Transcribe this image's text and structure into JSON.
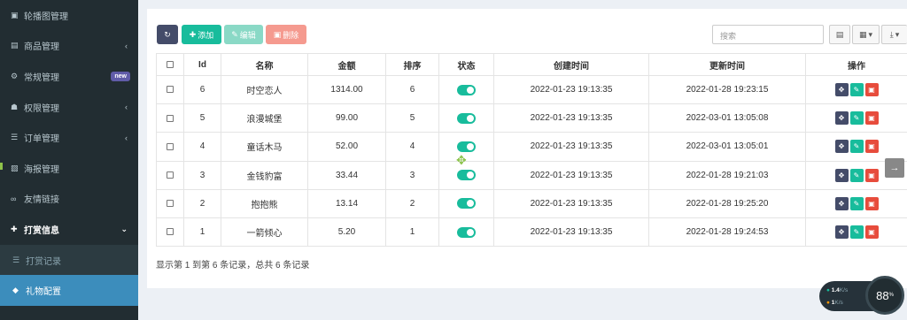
{
  "sidebar": {
    "items": [
      {
        "label": "轮播图管理",
        "icon": "image-icon",
        "glyph": "▣"
      },
      {
        "label": "商品管理",
        "icon": "book-icon",
        "glyph": "▤",
        "arrow": "‹"
      },
      {
        "label": "常规管理",
        "icon": "cogs-icon",
        "glyph": "⚙",
        "badge": "new"
      },
      {
        "label": "权限管理",
        "icon": "users-icon",
        "glyph": "☗",
        "arrow": "‹"
      },
      {
        "label": "订单管理",
        "icon": "list-icon",
        "glyph": "☰",
        "arrow": "‹"
      },
      {
        "label": "海报管理",
        "icon": "picture-icon",
        "glyph": "▨"
      },
      {
        "label": "友情链接",
        "icon": "link-icon",
        "glyph": "∞"
      },
      {
        "label": "打赏信息",
        "icon": "gift-icon",
        "glyph": "✚",
        "arrow": "⌄"
      },
      {
        "label": "打赏记录",
        "icon": "list-alt-icon",
        "glyph": "☰"
      },
      {
        "label": "礼物配置",
        "icon": "cube-icon",
        "glyph": "◆"
      }
    ]
  },
  "toolbar": {
    "refresh_glyph": "↻",
    "add_label": "添加",
    "edit_label": "编辑",
    "delete_label": "删除",
    "search_placeholder": "搜索"
  },
  "table": {
    "headers": [
      "Id",
      "名称",
      "金额",
      "排序",
      "状态",
      "创建时间",
      "更新时间",
      "操作"
    ],
    "rows": [
      {
        "id": "6",
        "name": "时空恋人",
        "amount": "1314.00",
        "sort": "6",
        "created": "2022-01-23 19:13:35",
        "updated": "2022-01-28 19:23:15"
      },
      {
        "id": "5",
        "name": "浪漫城堡",
        "amount": "99.00",
        "sort": "5",
        "created": "2022-01-23 19:13:35",
        "updated": "2022-03-01 13:05:08"
      },
      {
        "id": "4",
        "name": "童话木马",
        "amount": "52.00",
        "sort": "4",
        "created": "2022-01-23 19:13:35",
        "updated": "2022-03-01 13:05:01"
      },
      {
        "id": "3",
        "name": "金钱豹富",
        "amount": "33.44",
        "sort": "3",
        "created": "2022-01-23 19:13:35",
        "updated": "2022-01-28 19:21:03"
      },
      {
        "id": "2",
        "name": "抱抱熊",
        "amount": "13.14",
        "sort": "2",
        "created": "2022-01-23 19:13:35",
        "updated": "2022-01-28 19:25:20"
      },
      {
        "id": "1",
        "name": "一箭倾心",
        "amount": "5.20",
        "sort": "1",
        "created": "2022-01-23 19:13:35",
        "updated": "2022-01-28 19:24:53"
      }
    ]
  },
  "footer": {
    "summary": "显示第 1 到第 6 条记录，总共 6 条记录"
  },
  "network": {
    "up": "1.4",
    "up_unit": "K/s",
    "down": "1",
    "down_unit": "K/s",
    "percent": "88",
    "percent_unit": "%"
  },
  "colors": {
    "sidebar_bg": "#222d32",
    "active": "#3c8dbc",
    "success": "#18bc9c",
    "danger": "#e74c3c",
    "primary_dark": "#444c69"
  }
}
